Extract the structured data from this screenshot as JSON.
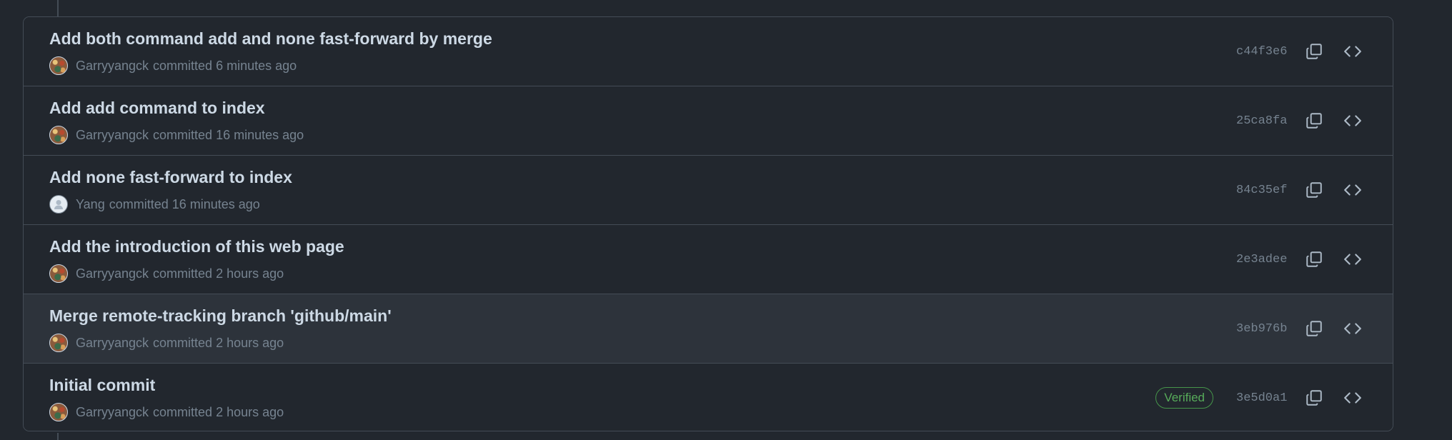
{
  "colors": {
    "background": "#22272e",
    "row_hover": "#2d333b",
    "border": "#444c56",
    "title_text": "#cdd9e5",
    "muted_text": "#768390",
    "verified": "#57ab5a"
  },
  "commits": [
    {
      "title": "Add both command add and none fast-forward by merge",
      "author": "Garryyangck",
      "time_text": "committed 6 minutes ago",
      "avatar": "pattern-avatar",
      "sha": "c44f3e6",
      "verified": false
    },
    {
      "title": "Add add command to index",
      "author": "Garryyangck",
      "time_text": "committed 16 minutes ago",
      "avatar": "pattern-avatar",
      "sha": "25ca8fa",
      "verified": false
    },
    {
      "title": "Add none fast-forward to index",
      "author": "Yang",
      "time_text": "committed 16 minutes ago",
      "avatar": "default-avatar",
      "sha": "84c35ef",
      "verified": false
    },
    {
      "title": "Add the introduction of this web page",
      "author": "Garryyangck",
      "time_text": "committed 2 hours ago",
      "avatar": "pattern-avatar",
      "sha": "2e3adee",
      "verified": false
    },
    {
      "title": "Merge remote-tracking branch 'github/main'",
      "author": "Garryyangck",
      "time_text": "committed 2 hours ago",
      "avatar": "pattern-avatar",
      "sha": "3eb976b",
      "verified": false,
      "hovered": true
    },
    {
      "title": "Initial commit",
      "author": "Garryyangck",
      "time_text": "committed 2 hours ago",
      "avatar": "pattern-avatar",
      "sha": "3e5d0a1",
      "verified": true,
      "verified_label": "Verified"
    }
  ],
  "icons": {
    "copy": "copy-icon",
    "browse": "code-icon"
  }
}
